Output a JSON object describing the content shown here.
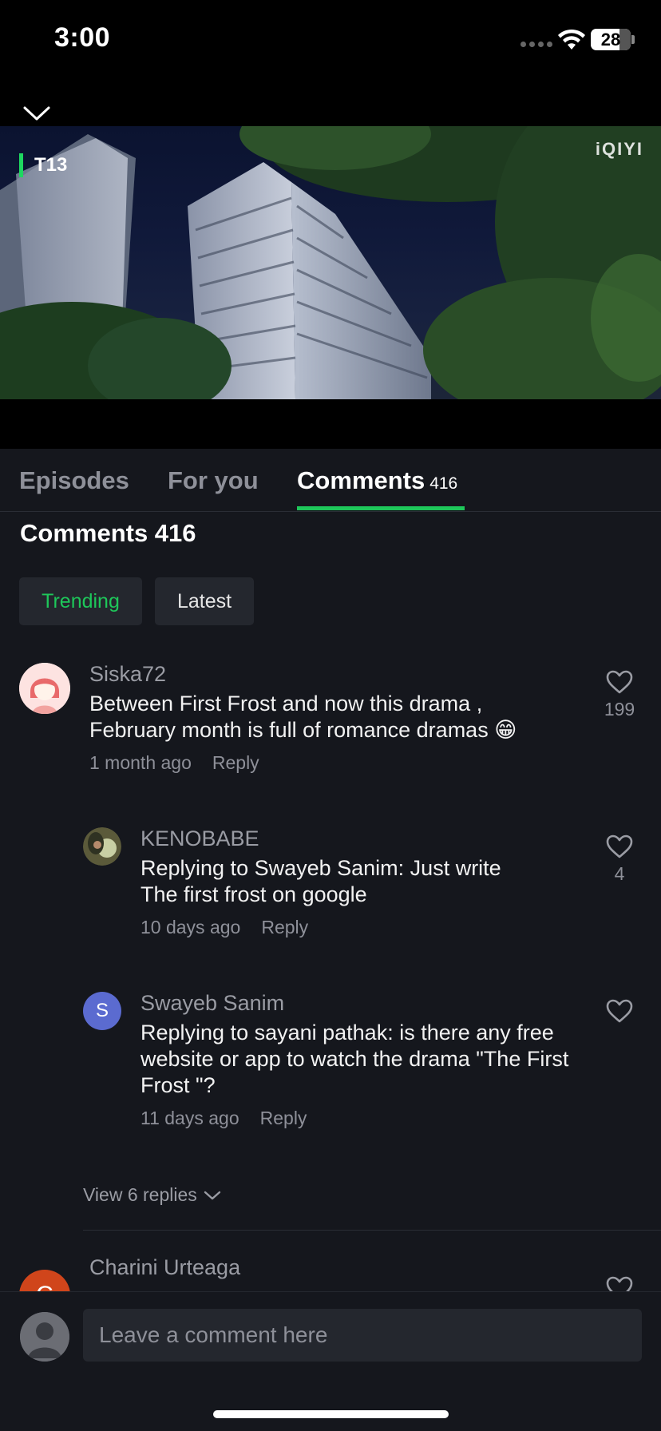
{
  "status_bar": {
    "time": "3:00",
    "battery": "28"
  },
  "video": {
    "rating": "T13",
    "logo": "iQIYI"
  },
  "tabs": [
    {
      "label": "Episodes"
    },
    {
      "label": "For you"
    },
    {
      "label": "Comments",
      "count": "416"
    }
  ],
  "comments_section": {
    "heading": "Comments 416",
    "filters": {
      "trending": "Trending",
      "latest": "Latest"
    },
    "comments": [
      {
        "username": "Siska72",
        "text": "Between First Frost and now this drama , February month is full of romance dramas 😁",
        "time": "1 month ago",
        "reply_label": "Reply",
        "likes": "199"
      },
      {
        "username": "KENOBABE",
        "text": "Replying to Swayeb Sanim: Just write The first frost on google",
        "time": "10 days ago",
        "reply_label": "Reply",
        "likes": "4"
      },
      {
        "username": "Swayeb Sanim",
        "avatar_letter": "S",
        "text": "Replying to sayani pathak: is there any free website or app to watch the drama \"The First Frost \"?",
        "time": "11 days ago",
        "reply_label": "Reply",
        "likes": ""
      },
      {
        "username": "Charini Urteaga",
        "avatar_letter": "C"
      }
    ],
    "view_replies": "View 6 replies"
  },
  "input": {
    "placeholder": "Leave a comment here"
  },
  "colors": {
    "accent": "#1ec75a",
    "background": "#15171d",
    "chip": "#24272e"
  }
}
